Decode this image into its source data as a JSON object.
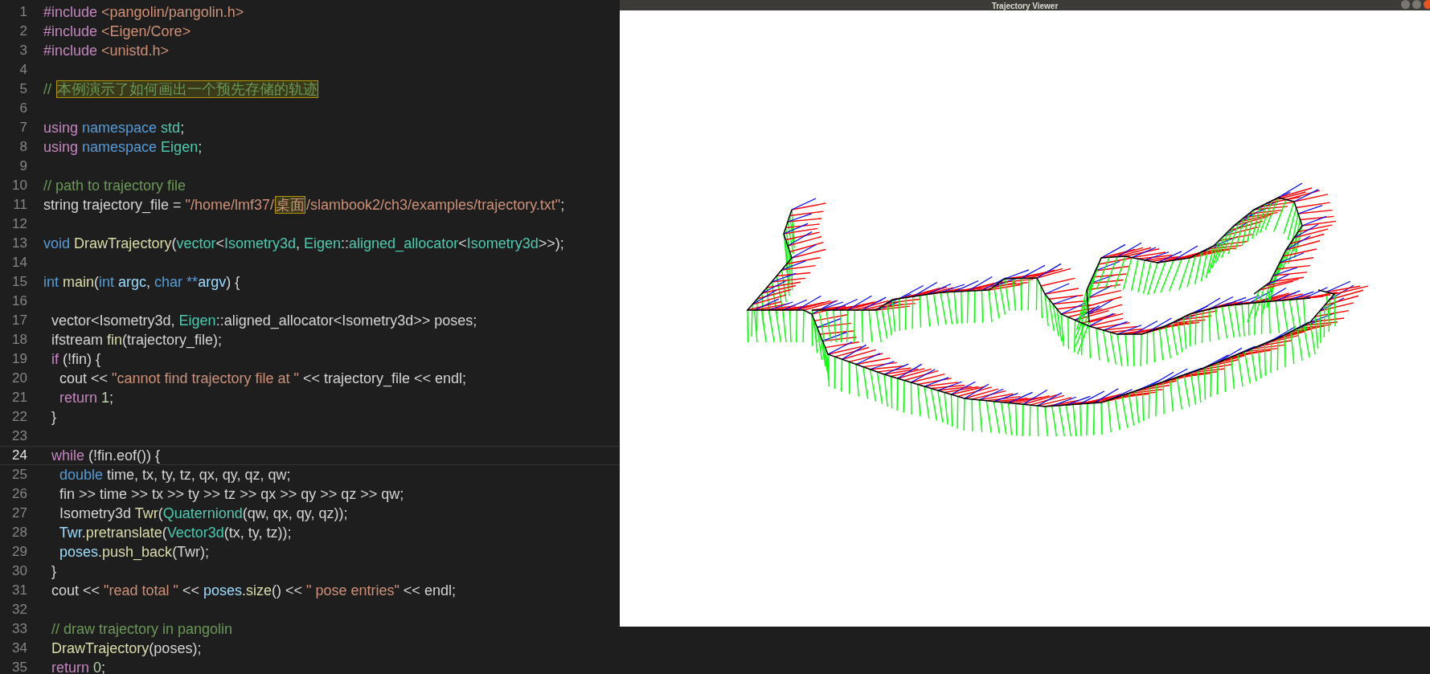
{
  "editor": {
    "lines": [
      {
        "n": "1",
        "current": false,
        "tokens": [
          {
            "text": "#include ",
            "kind": "kw"
          },
          {
            "text": "<pangolin/pangolin.h>",
            "kind": "str"
          }
        ]
      },
      {
        "n": "2",
        "current": false,
        "tokens": [
          {
            "text": "#include ",
            "kind": "kw"
          },
          {
            "text": "<Eigen/Core>",
            "kind": "str"
          }
        ]
      },
      {
        "n": "3",
        "current": false,
        "tokens": [
          {
            "text": "#include ",
            "kind": "kw"
          },
          {
            "text": "<unistd.h>",
            "kind": "str"
          }
        ]
      },
      {
        "n": "4",
        "current": false
      },
      {
        "n": "5",
        "current": false,
        "tokens": [
          {
            "text": "// ",
            "kind": "com"
          },
          {
            "text": "本例演示了如何画出一个预先存储的轨迹",
            "kind": "boxcom"
          }
        ]
      },
      {
        "n": "6",
        "current": false
      },
      {
        "n": "7",
        "current": false,
        "tokens": [
          {
            "text": "using ",
            "kind": "kw"
          },
          {
            "text": "namespace ",
            "kind": "type"
          },
          {
            "text": "std",
            "kind": "cls"
          },
          {
            "text": ";",
            "kind": "plain"
          }
        ]
      },
      {
        "n": "8",
        "current": false,
        "tokens": [
          {
            "text": "using ",
            "kind": "kw"
          },
          {
            "text": "namespace ",
            "kind": "type"
          },
          {
            "text": "Eigen",
            "kind": "cls"
          },
          {
            "text": ";",
            "kind": "plain"
          }
        ]
      },
      {
        "n": "9",
        "current": false
      },
      {
        "n": "10",
        "current": false,
        "tokens": [
          {
            "text": "// path to trajectory file",
            "kind": "com"
          }
        ]
      },
      {
        "n": "11",
        "current": false,
        "tokens": [
          {
            "text": "string trajectory_file = ",
            "kind": "plain"
          },
          {
            "text": "\"/home/lmf37/",
            "kind": "str"
          },
          {
            "text": "桌面",
            "kind": "boxstr"
          },
          {
            "text": "/slambook2/ch3/examples/trajectory.txt\"",
            "kind": "str"
          },
          {
            "text": ";",
            "kind": "plain"
          }
        ]
      },
      {
        "n": "12",
        "current": false
      },
      {
        "n": "13",
        "current": false,
        "tokens": [
          {
            "text": "void ",
            "kind": "type"
          },
          {
            "text": "DrawTrajectory",
            "kind": "fn"
          },
          {
            "text": "(",
            "kind": "plain"
          },
          {
            "text": "vector",
            "kind": "cls"
          },
          {
            "text": "<",
            "kind": "plain"
          },
          {
            "text": "Isometry3d",
            "kind": "cls"
          },
          {
            "text": ", ",
            "kind": "plain"
          },
          {
            "text": "Eigen",
            "kind": "cls"
          },
          {
            "text": "::",
            "kind": "plain"
          },
          {
            "text": "aligned_allocator",
            "kind": "cls"
          },
          {
            "text": "<",
            "kind": "plain"
          },
          {
            "text": "Isometry3d",
            "kind": "cls"
          },
          {
            "text": ">>);",
            "kind": "plain"
          }
        ]
      },
      {
        "n": "14",
        "current": false
      },
      {
        "n": "15",
        "current": false,
        "tokens": [
          {
            "text": "int ",
            "kind": "type"
          },
          {
            "text": "main",
            "kind": "fn"
          },
          {
            "text": "(",
            "kind": "plain"
          },
          {
            "text": "int ",
            "kind": "type"
          },
          {
            "text": "argc",
            "kind": "var"
          },
          {
            "text": ", ",
            "kind": "plain"
          },
          {
            "text": "char ",
            "kind": "type"
          },
          {
            "text": "**",
            "kind": "type"
          },
          {
            "text": "argv",
            "kind": "var"
          },
          {
            "text": ") {",
            "kind": "plain"
          }
        ]
      },
      {
        "n": "16",
        "current": false
      },
      {
        "n": "17",
        "current": false,
        "tokens": [
          {
            "text": "  vector<Isometry3d, ",
            "kind": "plain"
          },
          {
            "text": "Eigen",
            "kind": "cls"
          },
          {
            "text": "::aligned_allocator<Isometry3d>> poses;",
            "kind": "plain"
          }
        ]
      },
      {
        "n": "18",
        "current": false,
        "tokens": [
          {
            "text": "  ifstream ",
            "kind": "plain"
          },
          {
            "text": "fin",
            "kind": "fn"
          },
          {
            "text": "(trajectory_file);",
            "kind": "plain"
          }
        ]
      },
      {
        "n": "19",
        "current": false,
        "tokens": [
          {
            "text": "  if ",
            "kind": "kw"
          },
          {
            "text": "(!fin) {",
            "kind": "plain"
          }
        ]
      },
      {
        "n": "20",
        "current": false,
        "tokens": [
          {
            "text": "    cout << ",
            "kind": "plain"
          },
          {
            "text": "\"cannot find trajectory file at \"",
            "kind": "str"
          },
          {
            "text": " << trajectory_file << endl;",
            "kind": "plain"
          }
        ]
      },
      {
        "n": "21",
        "current": false,
        "tokens": [
          {
            "text": "    return ",
            "kind": "kw"
          },
          {
            "text": "1",
            "kind": "num"
          },
          {
            "text": ";",
            "kind": "plain"
          }
        ]
      },
      {
        "n": "22",
        "current": false,
        "tokens": [
          {
            "text": "  }",
            "kind": "plain"
          }
        ]
      },
      {
        "n": "23",
        "current": false
      },
      {
        "n": "24",
        "current": true,
        "tokens": [
          {
            "text": "  while ",
            "kind": "kw"
          },
          {
            "text": "(!fin.eof()) {",
            "kind": "plain"
          }
        ]
      },
      {
        "n": "25",
        "current": false,
        "tokens": [
          {
            "text": "    double ",
            "kind": "type"
          },
          {
            "text": "time, tx, ty, tz, qx, qy, qz, qw;",
            "kind": "plain"
          }
        ]
      },
      {
        "n": "26",
        "current": false,
        "tokens": [
          {
            "text": "    fin >> time >> tx >> ty >> tz >> qx >> qy >> qz >> qw;",
            "kind": "plain"
          }
        ]
      },
      {
        "n": "27",
        "current": false,
        "tokens": [
          {
            "text": "    Isometry3d ",
            "kind": "plain"
          },
          {
            "text": "Twr",
            "kind": "fn"
          },
          {
            "text": "(",
            "kind": "plain"
          },
          {
            "text": "Quaterniond",
            "kind": "cls"
          },
          {
            "text": "(qw, qx, qy, qz));",
            "kind": "plain"
          }
        ]
      },
      {
        "n": "28",
        "current": false,
        "tokens": [
          {
            "text": "    Twr",
            "kind": "var"
          },
          {
            "text": ".pretranslate",
            "kind": "fn"
          },
          {
            "text": "(",
            "kind": "plain"
          },
          {
            "text": "Vector3d",
            "kind": "cls"
          },
          {
            "text": "(tx, ty, tz));",
            "kind": "plain"
          }
        ]
      },
      {
        "n": "29",
        "current": false,
        "tokens": [
          {
            "text": "    poses",
            "kind": "var"
          },
          {
            "text": ".push_back",
            "kind": "fn"
          },
          {
            "text": "(Twr);",
            "kind": "plain"
          }
        ]
      },
      {
        "n": "30",
        "current": false,
        "tokens": [
          {
            "text": "  }",
            "kind": "plain"
          }
        ]
      },
      {
        "n": "31",
        "current": false,
        "tokens": [
          {
            "text": "  cout << ",
            "kind": "plain"
          },
          {
            "text": "\"read total \"",
            "kind": "str"
          },
          {
            "text": " << ",
            "kind": "plain"
          },
          {
            "text": "poses",
            "kind": "var"
          },
          {
            "text": ".size",
            "kind": "fn"
          },
          {
            "text": "() << ",
            "kind": "plain"
          },
          {
            "text": "\" pose entries\"",
            "kind": "str"
          },
          {
            "text": " << endl;",
            "kind": "plain"
          }
        ]
      },
      {
        "n": "32",
        "current": false
      },
      {
        "n": "33",
        "current": false,
        "tokens": [
          {
            "text": "  // draw trajectory in pangolin",
            "kind": "com"
          }
        ]
      },
      {
        "n": "34",
        "current": false,
        "tokens": [
          {
            "text": "  DrawTrajectory",
            "kind": "fn"
          },
          {
            "text": "(poses);",
            "kind": "plain"
          }
        ]
      },
      {
        "n": "35",
        "current": false,
        "tokens": [
          {
            "text": "  return ",
            "kind": "kw"
          },
          {
            "text": "0",
            "kind": "num"
          },
          {
            "text": ";",
            "kind": "plain"
          }
        ]
      }
    ]
  },
  "viewer": {
    "title": "Trajectory Viewer"
  }
}
